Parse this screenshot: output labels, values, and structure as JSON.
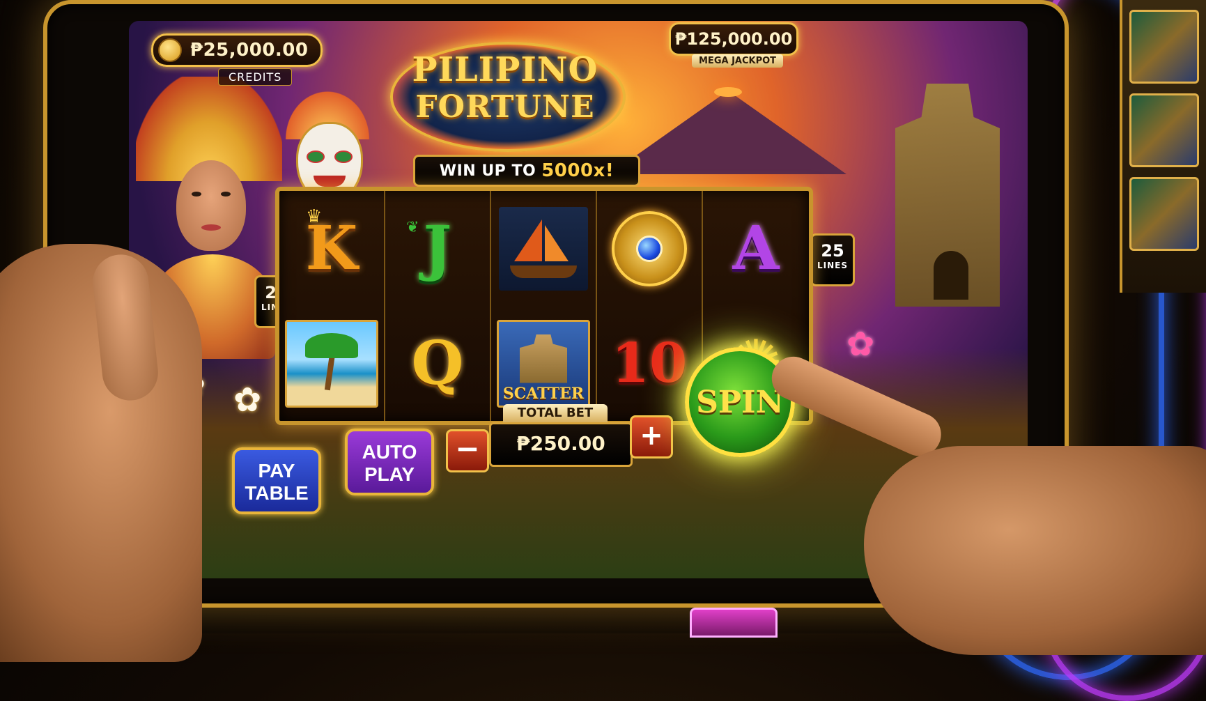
{
  "game": {
    "logo_line1": "PILIPINO",
    "logo_line2": "FORTUNE",
    "win_banner_prefix": "WIN UP TO",
    "win_banner_highlight": "5000x!"
  },
  "credits": {
    "value": "₱25,000.00",
    "label": "CREDITS"
  },
  "jackpot": {
    "value": "₱125,000.00",
    "label": "MEGA JACKPOT"
  },
  "paylines": {
    "count": "25",
    "label": "LINES"
  },
  "reels": {
    "symbols": [
      "K",
      "J",
      "ship",
      "medallion",
      "A",
      "palm-beach",
      "Q",
      "scatter",
      "10",
      "sun-flower"
    ],
    "scatter_label": "SCATTER"
  },
  "controls": {
    "pay_table_label": "PAY TABLE",
    "auto_play_label": "AUTO PLAY",
    "total_bet_label": "TOTAL BET",
    "total_bet_value": "₱250.00",
    "minus_label": "−",
    "plus_label": "+",
    "spin_label": "SPIN"
  },
  "colors": {
    "frame_gold": "#c8952d",
    "spin_green": "#2a9a1a",
    "pay_table_blue": "#1a2a9a",
    "auto_play_purple": "#5a1a9a"
  },
  "icons": [
    "coin-icon",
    "crown-icon",
    "leaf-icon",
    "ship-icon",
    "gem-icon",
    "palm-tree-icon",
    "church-icon",
    "sun-flower-icon"
  ]
}
